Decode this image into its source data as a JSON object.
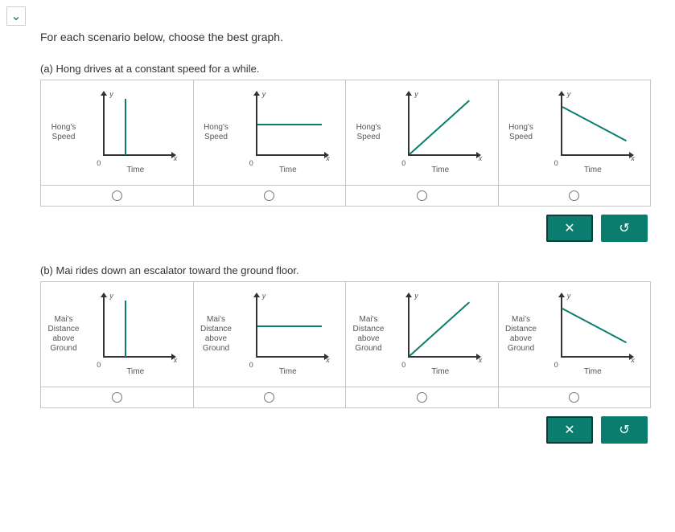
{
  "instruction": "For each scenario below, choose the best graph.",
  "axis": {
    "y_letter": "y",
    "x_letter": "x",
    "origin": "0"
  },
  "questions": [
    {
      "id": "a",
      "prompt": "(a) Hong drives at a constant speed for a while.",
      "ylabel": "Hong's Speed",
      "xlabel": "Time"
    },
    {
      "id": "b",
      "prompt": "(b) Mai rides down an escalator toward the ground floor.",
      "ylabel": "Mai's Distance above Ground",
      "xlabel": "Time"
    }
  ],
  "chart_data": [
    {
      "question": "a",
      "options": [
        {
          "type": "line",
          "shape": "vertical",
          "points": [
            [
              0.35,
              0
            ],
            [
              0.35,
              1
            ]
          ],
          "xlabel": "Time",
          "ylabel": "Hong's Speed"
        },
        {
          "type": "line",
          "shape": "horizontal",
          "points": [
            [
              0,
              0.55
            ],
            [
              1,
              0.55
            ]
          ],
          "xlabel": "Time",
          "ylabel": "Hong's Speed"
        },
        {
          "type": "line",
          "shape": "increasing",
          "points": [
            [
              0,
              0
            ],
            [
              1,
              1
            ]
          ],
          "xlabel": "Time",
          "ylabel": "Hong's Speed"
        },
        {
          "type": "line",
          "shape": "decreasing",
          "points": [
            [
              0,
              0.9
            ],
            [
              1,
              0.35
            ]
          ],
          "xlabel": "Time",
          "ylabel": "Hong's Speed"
        }
      ]
    },
    {
      "question": "b",
      "options": [
        {
          "type": "line",
          "shape": "vertical",
          "points": [
            [
              0.35,
              0
            ],
            [
              0.35,
              1
            ]
          ],
          "xlabel": "Time",
          "ylabel": "Mai's Distance above Ground"
        },
        {
          "type": "line",
          "shape": "horizontal",
          "points": [
            [
              0,
              0.55
            ],
            [
              1,
              0.55
            ]
          ],
          "xlabel": "Time",
          "ylabel": "Mai's Distance above Ground"
        },
        {
          "type": "line",
          "shape": "increasing",
          "points": [
            [
              0,
              0
            ],
            [
              1,
              1
            ]
          ],
          "xlabel": "Time",
          "ylabel": "Mai's Distance above Ground"
        },
        {
          "type": "line",
          "shape": "decreasing",
          "points": [
            [
              0,
              0.9
            ],
            [
              1,
              0.35
            ]
          ],
          "xlabel": "Time",
          "ylabel": "Mai's Distance above Ground"
        }
      ]
    }
  ],
  "buttons": {
    "close": "✕",
    "reset": "↺"
  }
}
